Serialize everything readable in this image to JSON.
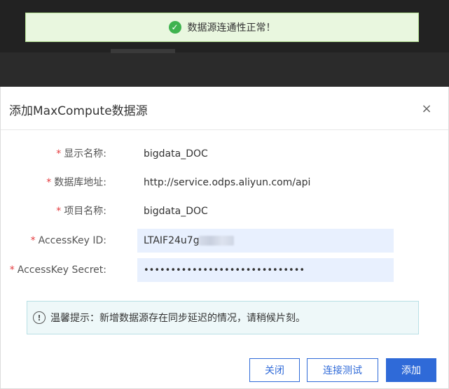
{
  "toast": {
    "icon": "check-circle-icon",
    "message": "数据源连通性正常！"
  },
  "dialog": {
    "title": "添加MaxCompute数据源",
    "close_glyph": "×",
    "required_mark": "*",
    "fields": [
      {
        "label": "显示名称:",
        "value": "bigdata_DOC"
      },
      {
        "label": "数据库地址:",
        "value": "http://service.odps.aliyun.com/api"
      },
      {
        "label": "项目名称:",
        "value": "bigdata_DOC"
      },
      {
        "label": "AccessKey ID:",
        "value": "LTAIF24u7g"
      },
      {
        "label": "AccessKey Secret:",
        "value": "••••••••••••••••••••••••••••••"
      }
    ],
    "notice": {
      "icon": "info-circle-icon",
      "text": "温馨提示：新增数据源存在同步延迟的情况，请稍候片刻。"
    },
    "buttons": {
      "close": "关闭",
      "test": "连接测试",
      "add": "添加"
    }
  },
  "colors": {
    "primary": "#2f6ad8",
    "success": "#3fb34f",
    "required": "#e4393c",
    "toast_bg": "#e9f7df",
    "notice_bg": "#eef8f9"
  }
}
